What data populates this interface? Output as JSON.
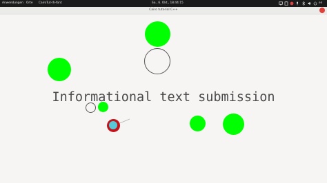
{
  "topbar": {
    "activities": "Anwendungen",
    "places": "Orte",
    "app_menu": "CairoTut-rh-font",
    "clock": "So., 6. Okt., 18:44:15",
    "tray_icons": [
      "display-icon",
      "battery-icon",
      "microphone-icon",
      "network-icon",
      "bluetooth-icon",
      "volume-icon",
      "power-icon"
    ],
    "keyboard_layout": "en"
  },
  "window": {
    "title": "Cairo tutorial C++"
  },
  "canvas": {
    "info_text": "Informational text submission",
    "colors": {
      "green": "#00ff00",
      "cursor_red": "#c0141a",
      "cursor_center": "#57c8d6",
      "background": "#f6f5f4"
    }
  }
}
